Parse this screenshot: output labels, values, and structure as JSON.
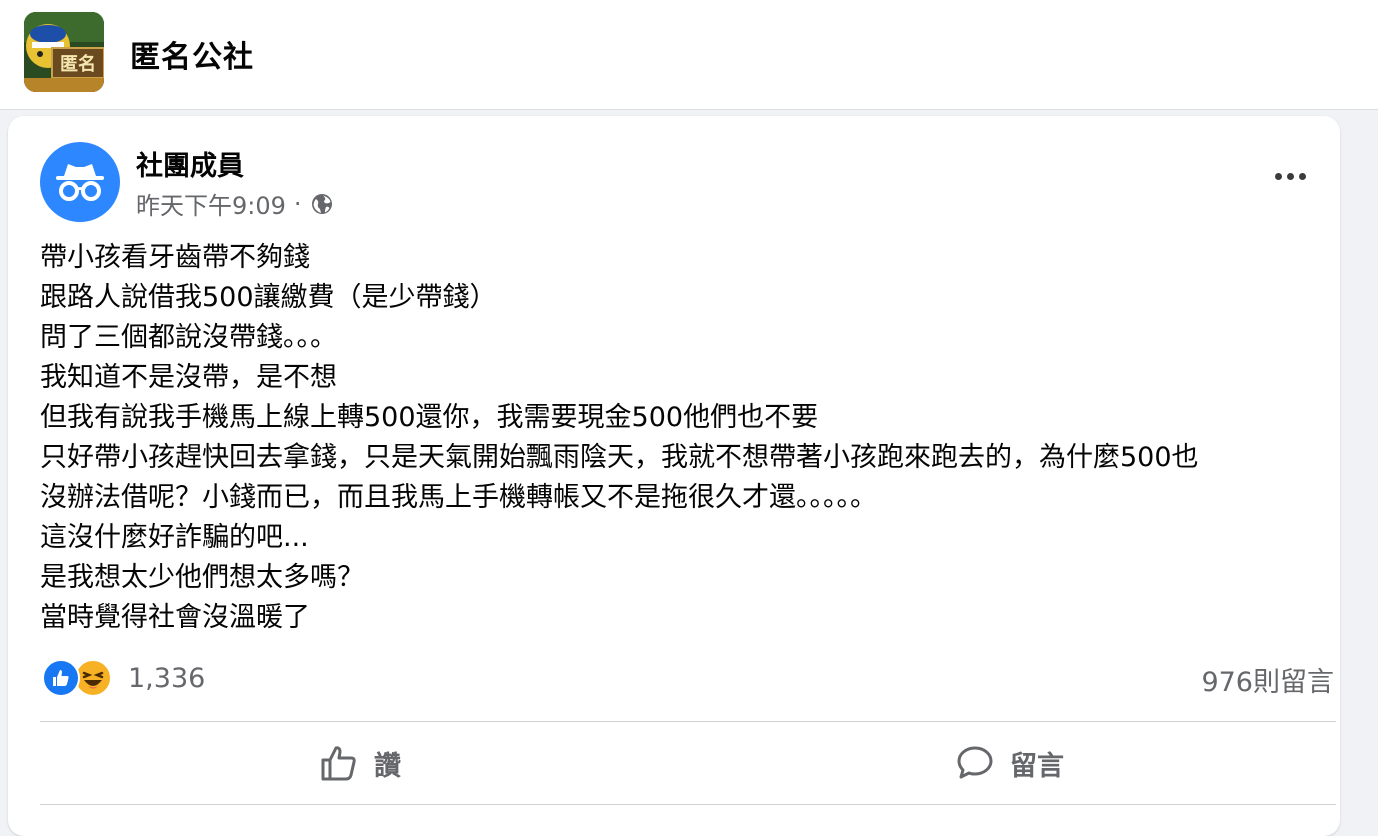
{
  "group": {
    "name": "匿名公社",
    "logo_text": "匿名"
  },
  "post": {
    "author": "社團成員",
    "timestamp": "昨天下午9:09",
    "separator": "·",
    "audience_icon": "globe-icon",
    "lines": [
      "帶小孩看牙齒帶不夠錢",
      "跟路人說借我500讓繳費（是少帶錢）",
      "問了三個都說沒帶錢。。。",
      "我知道不是沒帶，是不想",
      "但我有說我手機馬上線上轉500還你，我需要現金500他們也不要",
      "只好帶小孩趕快回去拿錢，只是天氣開始飄雨陰天，我就不想帶著小孩跑來跑去的，為什麼500也",
      "沒辦法借呢？小錢而已，而且我馬上手機轉帳又不是拖很久才還。。。。。",
      "這沒什麼好詐騙的吧...",
      "是我想太少他們想太多嗎？",
      "當時覺得社會沒溫暖了"
    ],
    "reaction_count": "1,336",
    "comment_count": "976則留言",
    "actions": {
      "like_label": "讚",
      "comment_label": "留言"
    }
  },
  "colors": {
    "accent": "#1877f2",
    "avatar_blue": "#2d88ff",
    "secondary_text": "#65676b",
    "haha_yellow": "#f7b125"
  }
}
